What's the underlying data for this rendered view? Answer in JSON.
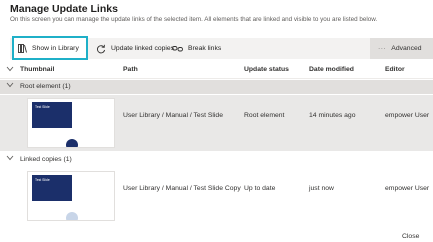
{
  "header": {
    "title": "Manage Update Links",
    "subtitle": "On this screen you can manage the update links of the selected item. All elements that are linked and visible to you are listed below."
  },
  "toolbar": {
    "show_in_library": "Show in Library",
    "update_linked_copies": "Update linked copies",
    "break_links": "Break links",
    "advanced": "Advanced",
    "more": "···",
    "accent_color": "#1fb0c8"
  },
  "table": {
    "columns": [
      "Thumbnail",
      "Path",
      "Update status",
      "Date modified",
      "Editor"
    ],
    "groups": [
      {
        "label": "Root element (1)",
        "rows": [
          {
            "thumbnail_text": "Test Slide",
            "path": "User Library / Manual / Test Slide",
            "status": "Root element",
            "modified": "14 minutes ago",
            "editor": "empower User"
          }
        ]
      },
      {
        "label": "Linked copies (1)",
        "rows": [
          {
            "thumbnail_text": "Test Slide",
            "path": "User Library / Manual / Test Slide Copy",
            "status": "Up to date",
            "modified": "just now",
            "editor": "empower User"
          }
        ]
      }
    ]
  },
  "footer": {
    "close": "Close"
  }
}
